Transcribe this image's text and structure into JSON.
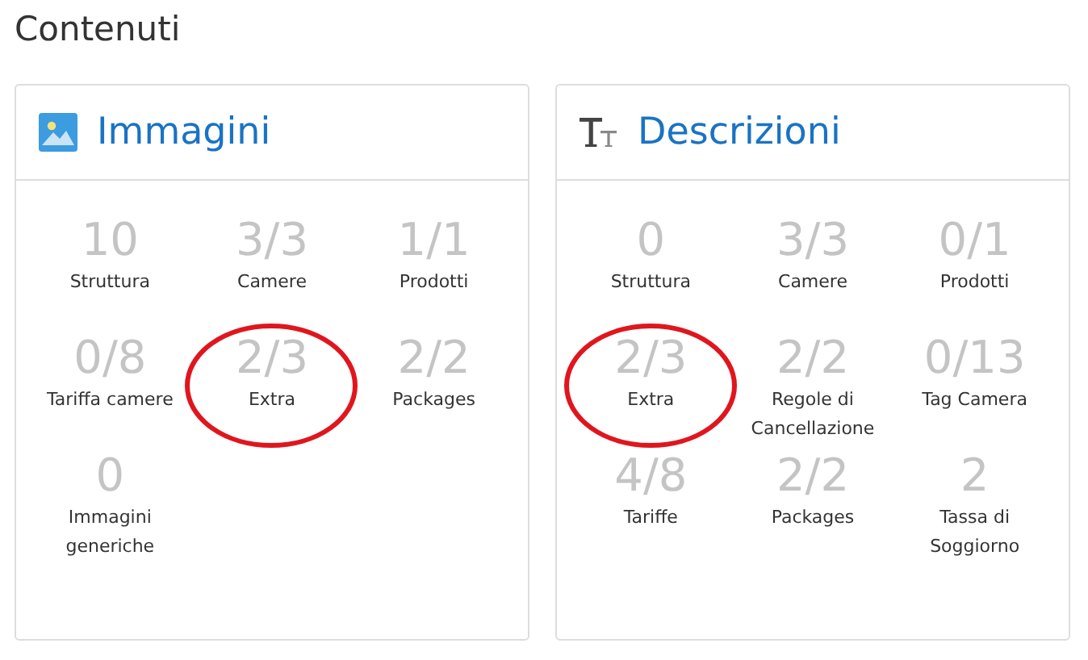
{
  "title": "Contenuti",
  "panels": [
    {
      "title": "Immagini",
      "kind": "image",
      "items": [
        {
          "value": "10",
          "label": "Struttura",
          "highlighted": false
        },
        {
          "value": "3/3",
          "label": "Camere",
          "highlighted": false
        },
        {
          "value": "1/1",
          "label": "Prodotti",
          "highlighted": false
        },
        {
          "value": "0/8",
          "label": "Tariffa camere",
          "highlighted": false
        },
        {
          "value": "2/3",
          "label": "Extra",
          "highlighted": true
        },
        {
          "value": "2/2",
          "label": "Packages",
          "highlighted": false
        },
        {
          "value": "0",
          "label": "Immagini generiche",
          "highlighted": false
        }
      ]
    },
    {
      "title": "Descrizioni",
      "kind": "text",
      "items": [
        {
          "value": "0",
          "label": "Struttura",
          "highlighted": false
        },
        {
          "value": "3/3",
          "label": "Camere",
          "highlighted": false
        },
        {
          "value": "0/1",
          "label": "Prodotti",
          "highlighted": false
        },
        {
          "value": "2/3",
          "label": "Extra",
          "highlighted": true
        },
        {
          "value": "2/2",
          "label": "Regole di Cancellazione",
          "highlighted": false
        },
        {
          "value": "0/13",
          "label": "Tag Camera",
          "highlighted": false
        },
        {
          "value": "4/8",
          "label": "Tariffe",
          "highlighted": false
        },
        {
          "value": "2/2",
          "label": "Packages",
          "highlighted": false
        },
        {
          "value": "2",
          "label": "Tassa di Soggiorno",
          "highlighted": false
        }
      ]
    }
  ]
}
